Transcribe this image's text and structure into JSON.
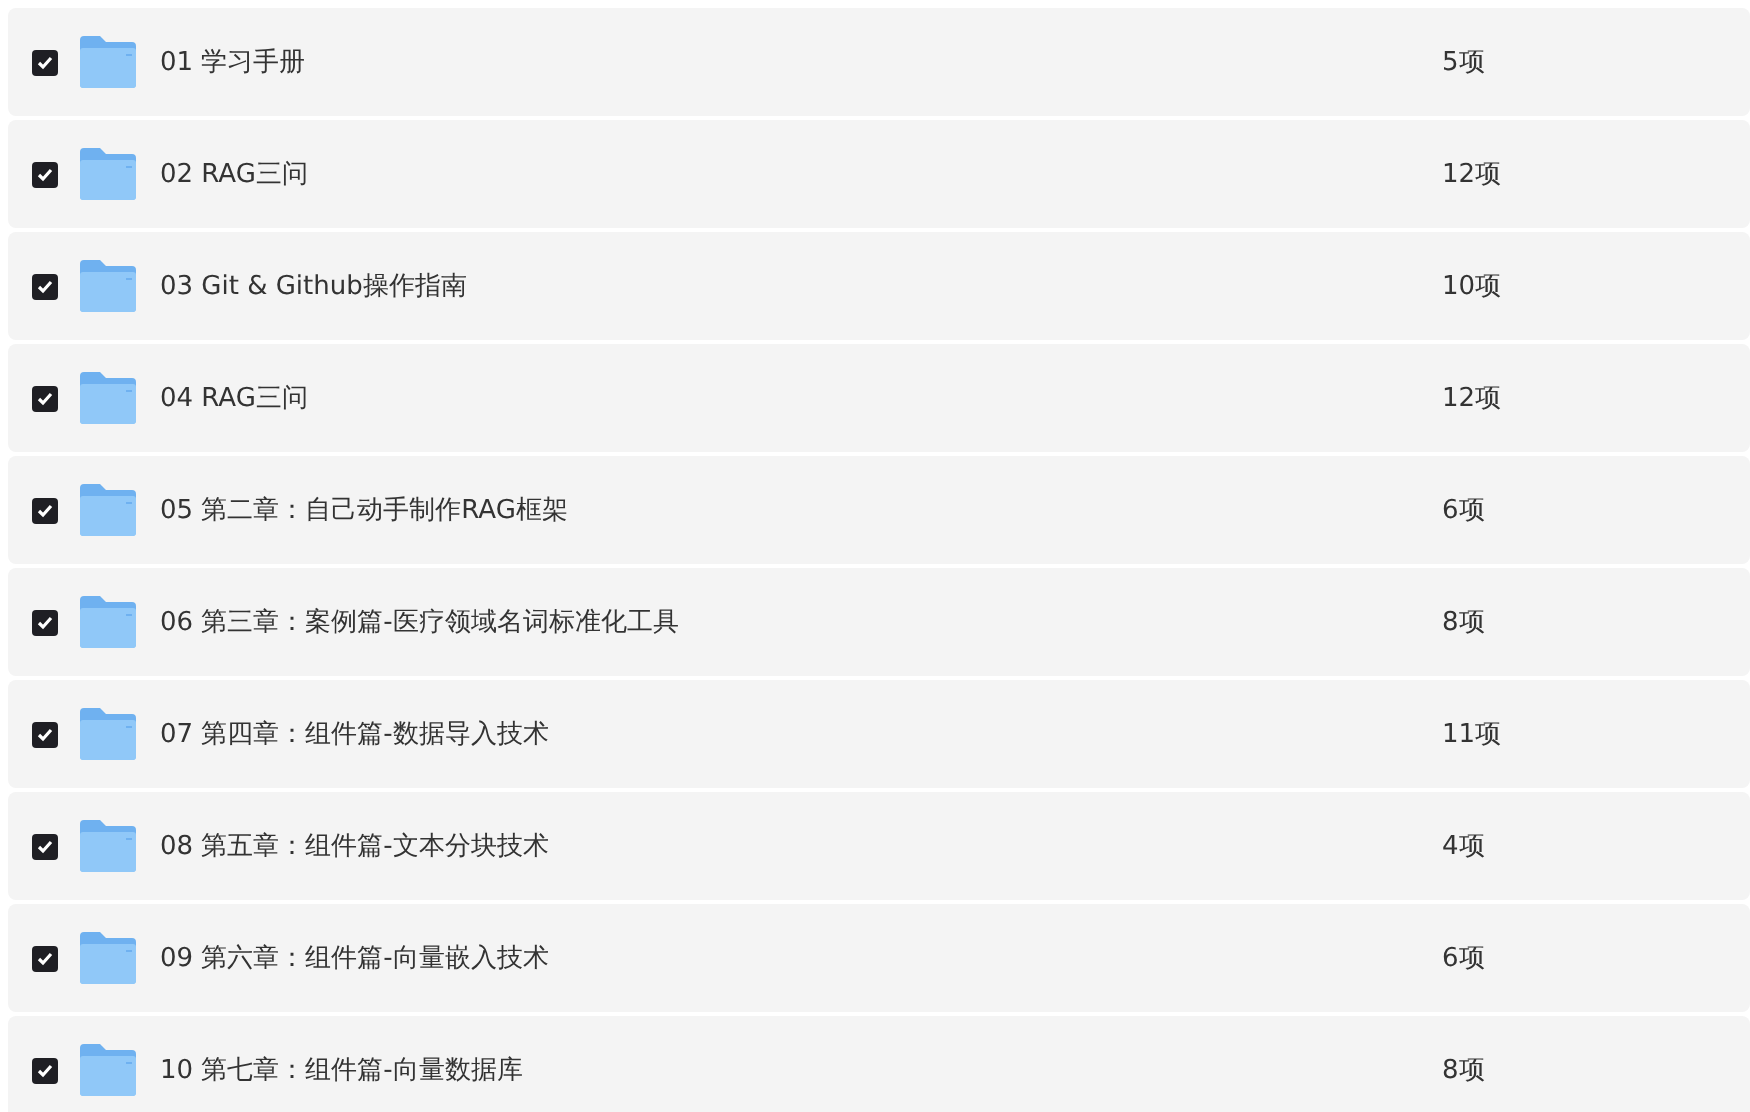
{
  "folders": [
    {
      "name": "01 学习手册",
      "count": "5项",
      "checked": true
    },
    {
      "name": "02 RAG三问",
      "count": "12项",
      "checked": true
    },
    {
      "name": "03 Git & Github操作指南",
      "count": "10项",
      "checked": true
    },
    {
      "name": "04 RAG三问",
      "count": "12项",
      "checked": true
    },
    {
      "name": "05 第二章：自己动手制作RAG框架",
      "count": "6项",
      "checked": true
    },
    {
      "name": "06 第三章：案例篇-医疗领域名词标准化工具",
      "count": "8项",
      "checked": true
    },
    {
      "name": "07 第四章：组件篇-数据导入技术",
      "count": "11项",
      "checked": true
    },
    {
      "name": "08 第五章：组件篇-文本分块技术",
      "count": "4项",
      "checked": true
    },
    {
      "name": "09 第六章：组件篇-向量嵌入技术",
      "count": "6项",
      "checked": true
    },
    {
      "name": "10 第七章：组件篇-向量数据库",
      "count": "8项",
      "checked": true
    }
  ]
}
